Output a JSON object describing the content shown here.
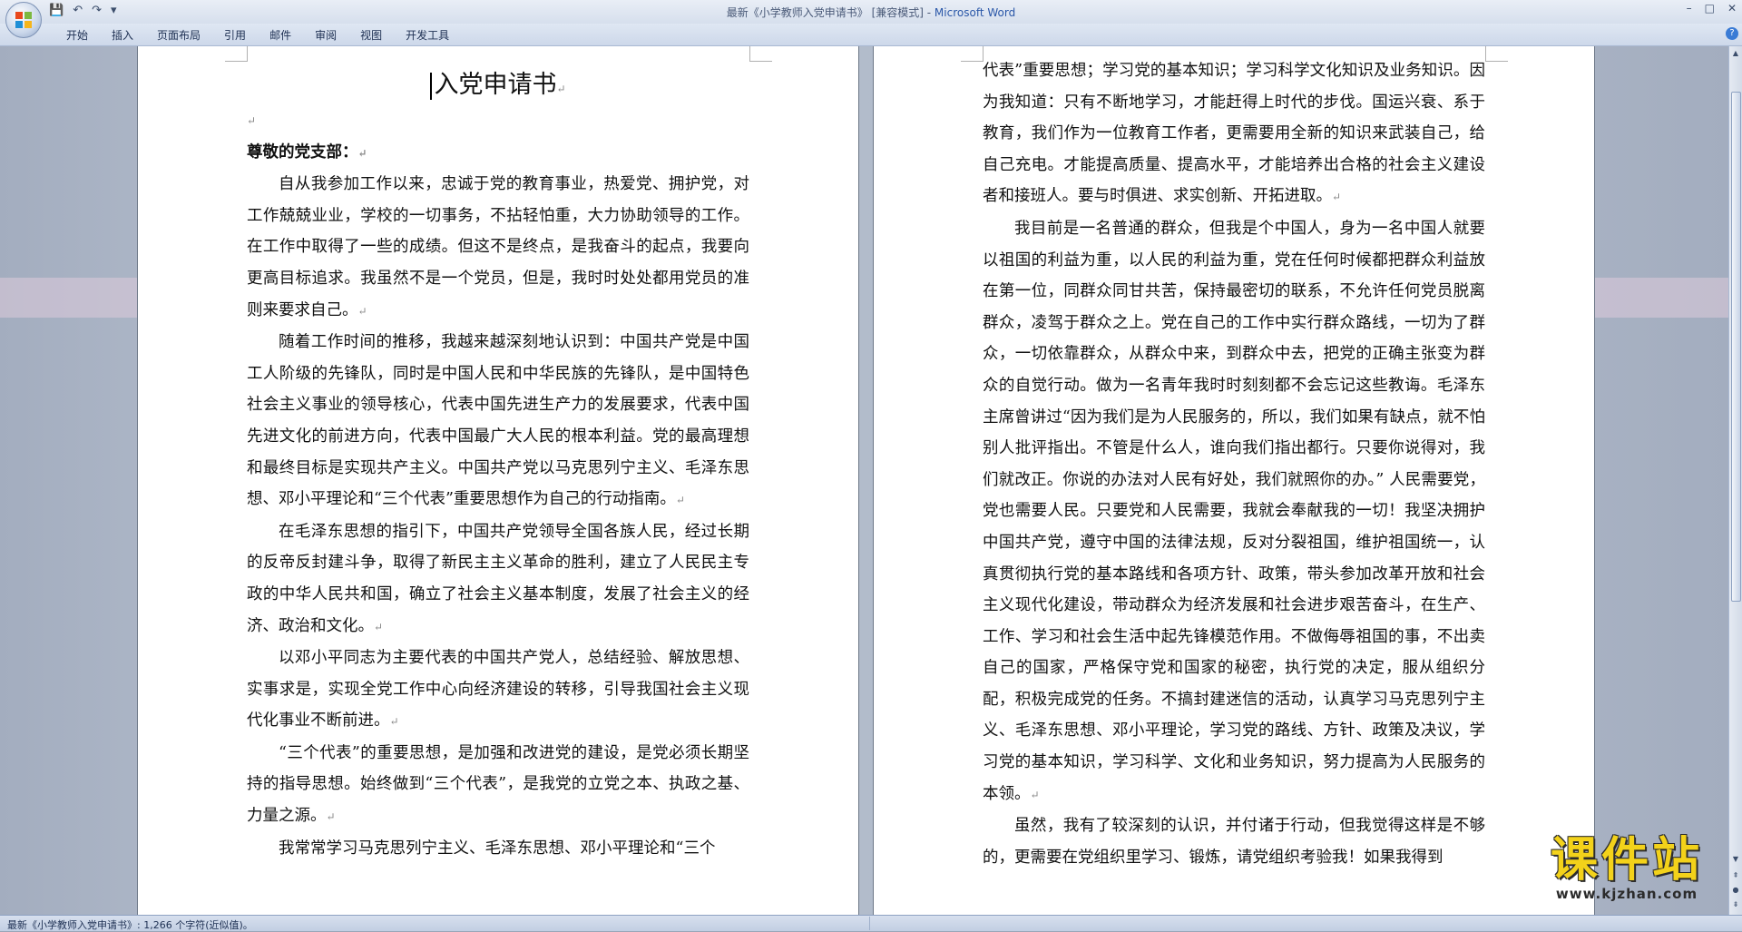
{
  "window": {
    "title": "最新《小学教师入党申请书》 [兼容模式] - ",
    "app_name": "Microsoft Word",
    "controls": [
      "–",
      "□",
      "✕"
    ]
  },
  "quick_access": {
    "save": "💾",
    "undo": "↶",
    "redo": "↷",
    "customize": "▾"
  },
  "ribbon": {
    "tabs": [
      "开始",
      "插入",
      "页面布局",
      "引用",
      "邮件",
      "审阅",
      "视图",
      "开发工具"
    ],
    "help": "?"
  },
  "document": {
    "title": "入党申请书",
    "left_page": {
      "salutation": "尊敬的党支部：",
      "paragraphs": [
        "自从我参加工作以来，忠诚于党的教育事业，热爱党、拥护党，对工作兢兢业业，学校的一切事务，不拈轻怕重，大力协助领导的工作。在工作中取得了一些的成绩。但这不是终点，是我奋斗的起点，我要向更高目标追求。我虽然不是一个党员，但是，我时时处处都用党员的准则来要求自己。",
        "随着工作时间的推移，我越来越深刻地认识到：中国共产党是中国工人阶级的先锋队，同时是中国人民和中华民族的先锋队，是中国特色社会主义事业的领导核心，代表中国先进生产力的发展要求，代表中国先进文化的前进方向，代表中国最广大人民的根本利益。党的最高理想和最终目标是实现共产主义。中国共产党以马克思列宁主义、毛泽东思想、邓小平理论和“三个代表”重要思想作为自己的行动指南。",
        "在毛泽东思想的指引下，中国共产党领导全国各族人民，经过长期的反帝反封建斗争，取得了新民主主义革命的胜利，建立了人民民主专政的中华人民共和国，确立了社会主义基本制度，发展了社会主义的经济、政治和文化。",
        "以邓小平同志为主要代表的中国共产党人，总结经验、解放思想、实事求是，实现全党工作中心向经济建设的转移，引导我国社会主义现代化事业不断前进。",
        "“三个代表”的重要思想，是加强和改进党的建设，是党必须长期坚持的指导思想。始终做到“三个代表”，是我党的立党之本、执政之基、力量之源。",
        "我常常学习马克思列宁主义、毛泽东思想、邓小平理论和“三个"
      ]
    },
    "right_page": {
      "paragraphs": [
        "代表”重要思想；学习党的基本知识；学习科学文化知识及业务知识。因为我知道：只有不断地学习，才能赶得上时代的步伐。国运兴衰、系于教育，我们作为一位教育工作者，更需要用全新的知识来武装自己，给自己充电。才能提高质量、提高水平，才能培养出合格的社会主义建设者和接班人。要与时俱进、求实创新、开拓进取。",
        "我目前是一名普通的群众，但我是个中国人，身为一名中国人就要以祖国的利益为重，以人民的利益为重，党在任何时候都把群众利益放在第一位，同群众同甘共苦，保持最密切的联系，不允许任何党员脱离群众，凌驾于群众之上。党在自己的工作中实行群众路线，一切为了群众，一切依靠群众，从群众中来，到群众中去，把党的正确主张变为群众的自觉行动。做为一名青年我时时刻刻都不会忘记这些教诲。毛泽东主席曾讲过“因为我们是为人民服务的，所以，我们如果有缺点，就不怕别人批评指出。不管是什么人，谁向我们指出都行。只要你说得对，我们就改正。你说的办法对人民有好处，我们就照你的办。” 人民需要党，党也需要人民。只要党和人民需要，我就会奉献我的一切！我坚决拥护中国共产党，遵守中国的法律法规，反对分裂祖国，维护祖国统一，认真贯彻执行党的基本路线和各项方针、政策，带头参加改革开放和社会主义现代化建设，带动群众为经济发展和社会进步艰苦奋斗，在生产、工作、学习和社会生活中起先锋模范作用。不做侮辱祖国的事，不出卖自己的国家，严格保守党和国家的秘密，执行党的决定，服从组织分配，积极完成党的任务。不搞封建迷信的活动，认真学习马克思列宁主义、毛泽东思想、邓小平理论，学习党的路线、方针、政策及决议，学习党的基本知识，学习科学、文化和业务知识，努力提高为人民服务的本领。",
        "虽然，我有了较深刻的认识，并付诸于行动，但我觉得这样是不够的，更需要在党组织里学习、锻炼，请党组织考验我！如果我得到"
      ]
    },
    "paragraph_mark": "↵"
  },
  "status_bar": {
    "text": "最新《小学教师入党申请书》: 1,266 个字符(近似值)。"
  },
  "watermark": {
    "main": "课件站",
    "url": "www.kjzhan.com"
  }
}
